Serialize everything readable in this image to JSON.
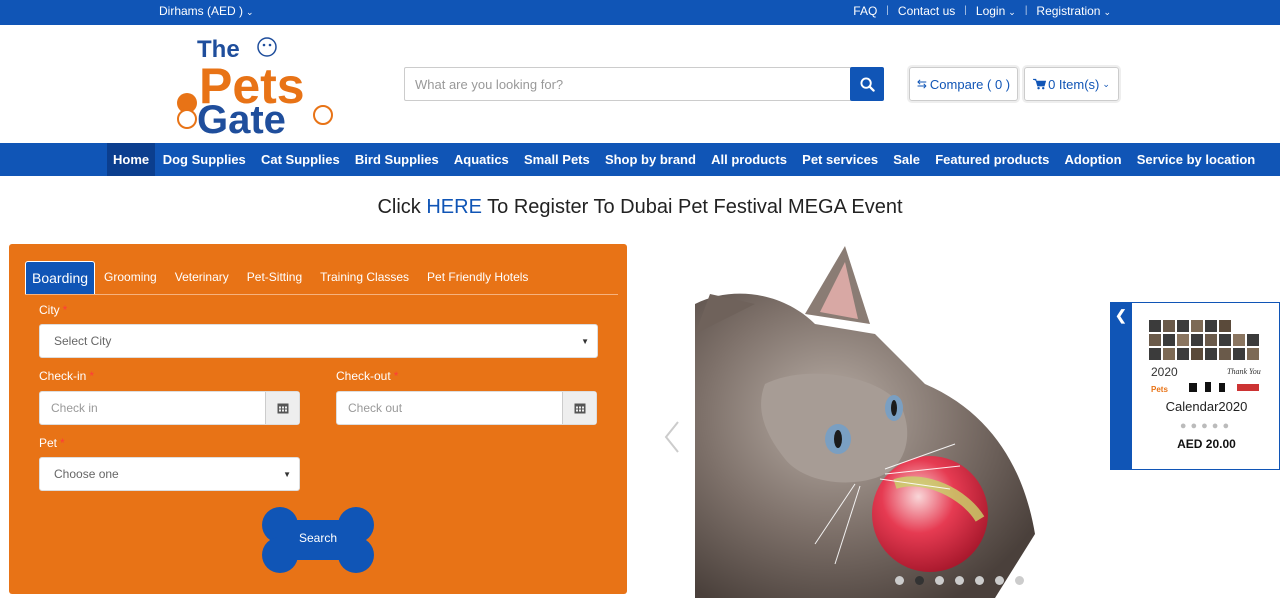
{
  "topbar": {
    "currency": "Dirhams (AED )",
    "faq": "FAQ",
    "contact": "Contact us",
    "login": "Login",
    "registration": "Registration"
  },
  "header": {
    "logo_text": "The Pets Gate",
    "search_placeholder": "What are you looking for?",
    "compare_label": "Compare ( 0 )",
    "cart_label": "0 Item(s)"
  },
  "nav": {
    "items": [
      "Home",
      "Dog Supplies",
      "Cat Supplies",
      "Bird Supplies",
      "Aquatics",
      "Small Pets",
      "Shop by brand",
      "All products",
      "Pet services",
      "Sale",
      "Featured products",
      "Adoption",
      "Service by location"
    ],
    "active": "Home"
  },
  "banner": {
    "prefix": "Click ",
    "link": "HERE",
    "suffix": " To Register To Dubai Pet Festival MEGA Event"
  },
  "booking": {
    "tabs": [
      "Boarding",
      "Grooming",
      "Veterinary",
      "Pet-Sitting",
      "Training Classes",
      "Pet Friendly Hotels"
    ],
    "active_tab": "Boarding",
    "city_label": "City",
    "city_value": "Select City",
    "checkin_label": "Check-in",
    "checkin_placeholder": "Check in",
    "checkout_label": "Check-out",
    "checkout_placeholder": "Check out",
    "pet_label": "Pet",
    "pet_value": "Choose one",
    "required_mark": "*",
    "search_label": "Search"
  },
  "slider": {
    "slide_count": 7,
    "active_slide": 2
  },
  "side_widget": {
    "product_name": "Calendar2020",
    "price": "AED 20.00",
    "rating_max": 5,
    "rating": 0
  },
  "colors": {
    "brand_blue": "#1055b6",
    "orange": "#e87316",
    "required_red": "#ff3b3b"
  }
}
